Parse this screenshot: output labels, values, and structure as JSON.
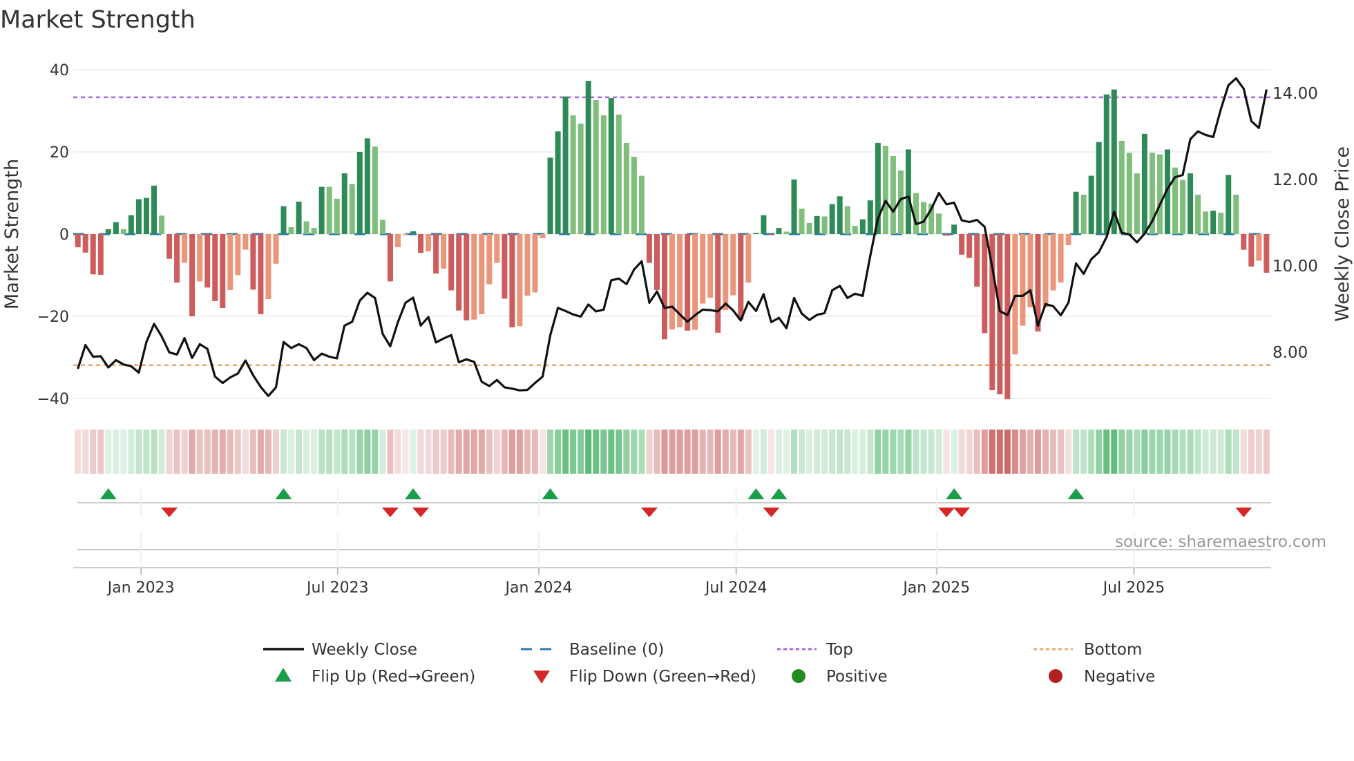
{
  "chart_data": {
    "type": "bar",
    "title": "Market Strength",
    "ylabel": "Market Strength",
    "y2label": "Weekly Close Price",
    "ylim": [
      -43,
      43
    ],
    "y2lim": [
      6.6,
      14.6
    ],
    "y_ticks": [
      {
        "value": 40,
        "label": "40"
      },
      {
        "value": 20,
        "label": "20"
      },
      {
        "value": 0,
        "label": "0"
      },
      {
        "value": -20,
        "label": "−20"
      },
      {
        "value": -40,
        "label": "−40"
      }
    ],
    "y2_ticks": [
      {
        "value": 14,
        "label": "14.00"
      },
      {
        "value": 12,
        "label": "12.00"
      },
      {
        "value": 10,
        "label": "10.00"
      },
      {
        "value": 8,
        "label": "8.00"
      }
    ],
    "x_ticks": [
      {
        "week": 8.3,
        "label": "Jan 2023"
      },
      {
        "week": 34.1,
        "label": "Jul 2023"
      },
      {
        "week": 60.5,
        "label": "Jan 2024"
      },
      {
        "week": 86.4,
        "label": "Jul 2024"
      },
      {
        "week": 112.7,
        "label": "Jan 2025"
      },
      {
        "week": 138.6,
        "label": "Jul 2025"
      }
    ],
    "top_level": 33.3,
    "bottom_level": -31.9,
    "baseline": 0,
    "strength": [
      -3.2,
      -4.5,
      -9.8,
      -9.9,
      1.2,
      2.9,
      1.2,
      4.6,
      8.5,
      8.8,
      11.8,
      4.5,
      -6,
      -11.8,
      -7,
      -20,
      -11.5,
      -13,
      -16.3,
      -18,
      -13.6,
      -10,
      -3.8,
      -13.5,
      -19.5,
      -15.8,
      -7.2,
      6.8,
      1.7,
      7.9,
      3.1,
      1.5,
      11.5,
      11.5,
      8.6,
      14.8,
      12.2,
      20,
      23.3,
      21.3,
      3.5,
      -11.5,
      -3.2,
      -0.2,
      0.7,
      -4.6,
      -4.2,
      -9.6,
      -8.4,
      -13.7,
      -18.6,
      -21,
      -20.8,
      -19.5,
      -12.2,
      -7,
      -15.7,
      -22.7,
      -22.4,
      -15,
      -14.2,
      -1,
      18.6,
      25,
      33.5,
      28.9,
      26.9,
      37.3,
      32.6,
      28.9,
      33.1,
      29.1,
      22.2,
      18.8,
      14.2,
      -7,
      -13.6,
      -25.6,
      -23.2,
      -22.7,
      -23.5,
      -23.3,
      -16.9,
      -15.5,
      -24,
      -18.5,
      -14.9,
      -20.8,
      -11.8,
      0.3,
      4.6,
      -0.2,
      1.5,
      0.6,
      13.3,
      6.2,
      2.7,
      4.4,
      4.3,
      7.3,
      9.2,
      6.8,
      2,
      3.6,
      8.2,
      22.2,
      21.5,
      19,
      15.5,
      20.6,
      10,
      7.8,
      7.4,
      5,
      -0.4,
      2.3,
      -5,
      -5.8,
      -12.8,
      -24.1,
      -38,
      -39,
      -40.2,
      -29.3,
      -22.3,
      -17.8,
      -23.7,
      -17.8,
      -13.7,
      -11.8,
      -2.7,
      10.3,
      9.6,
      14.2,
      22.4,
      34,
      35.2,
      22.7,
      19.8,
      14.8,
      24.4,
      19.8,
      19.4,
      20.6,
      16.2,
      13.2,
      14.8,
      9.6,
      5.5,
      5.7,
      5.2,
      14.4,
      9.6,
      -3.8,
      -7.9,
      -6.5,
      -9.4
    ],
    "weekly_close": [
      7.6,
      8.15,
      7.88,
      7.89,
      7.63,
      7.8,
      7.7,
      7.66,
      7.51,
      8.22,
      8.64,
      8.35,
      7.98,
      7.93,
      8.31,
      7.85,
      8.17,
      8.06,
      7.42,
      7.27,
      7.4,
      7.49,
      7.79,
      7.45,
      7.18,
      6.97,
      7.17,
      8.22,
      8.08,
      8.17,
      8.08,
      7.8,
      7.95,
      7.88,
      7.84,
      8.6,
      8.69,
      9.18,
      9.36,
      9.24,
      8.41,
      8.12,
      8.68,
      9.13,
      9.25,
      8.6,
      8.8,
      8.21,
      8.3,
      8.38,
      7.75,
      7.82,
      7.76,
      7.3,
      7.2,
      7.34,
      7.17,
      7.14,
      7.1,
      7.11,
      7.27,
      7.42,
      8.38,
      9.01,
      8.94,
      8.86,
      8.81,
      9.09,
      8.93,
      8.97,
      9.65,
      9.69,
      9.56,
      9.9,
      10.09,
      9.13,
      9.39,
      9.01,
      9.04,
      8.86,
      8.69,
      8.84,
      8.97,
      8.96,
      8.93,
      9.11,
      8.95,
      8.72,
      9.15,
      8.94,
      9.33,
      8.68,
      8.78,
      8.54,
      9.24,
      8.88,
      8.73,
      8.85,
      8.89,
      9.42,
      9.52,
      9.24,
      9.34,
      9.29,
      10.22,
      11.08,
      11.49,
      11.24,
      11.53,
      11.59,
      10.95,
      11.01,
      11.3,
      11.67,
      11.41,
      11.45,
      11.04,
      11.0,
      11.05,
      10.89,
      9.96,
      8.94,
      8.84,
      9.29,
      9.29,
      9.42,
      8.6,
      9.1,
      9.05,
      8.84,
      9.13,
      10.04,
      9.8,
      10.14,
      10.3,
      10.65,
      11.24,
      10.75,
      10.71,
      10.53,
      10.73,
      11.02,
      11.4,
      11.77,
      12.04,
      12.09,
      12.92,
      13.1,
      13.02,
      12.97,
      13.61,
      14.17,
      14.33,
      14.09,
      13.34,
      13.18,
      14.07
    ],
    "legend": [
      {
        "label": "Weekly Close",
        "kind": "line"
      },
      {
        "label": "Baseline (0)",
        "kind": "dash"
      },
      {
        "label": "Top",
        "kind": "dot-top"
      },
      {
        "label": "Bottom",
        "kind": "dot-bottom"
      },
      {
        "label": "Flip Up (Red→Green)",
        "kind": "tri-up"
      },
      {
        "label": "Flip Down (Green→Red)",
        "kind": "tri-down"
      },
      {
        "label": "Positive",
        "kind": "circle-pos"
      },
      {
        "label": "Negative",
        "kind": "circle-neg"
      }
    ],
    "legend_placement": "bottom",
    "grid": true,
    "source": "source: sharemaestro.com",
    "colors": {
      "pos_dark": "#2e8b57",
      "pos_light": "#7fbf7b",
      "neg_dark": "#cd5c5c",
      "neg_light": "#e9967a",
      "price": "#111111",
      "baseline": "#2a7ab0",
      "top": "#a866e0",
      "bottom": "#f0a868",
      "flip_up": "#1a9e4a",
      "flip_down": "#d62728",
      "positive": "#228b22",
      "negative": "#b22222",
      "heat_pos": "#3fae5f",
      "heat_neg": "#c85a5a"
    }
  }
}
